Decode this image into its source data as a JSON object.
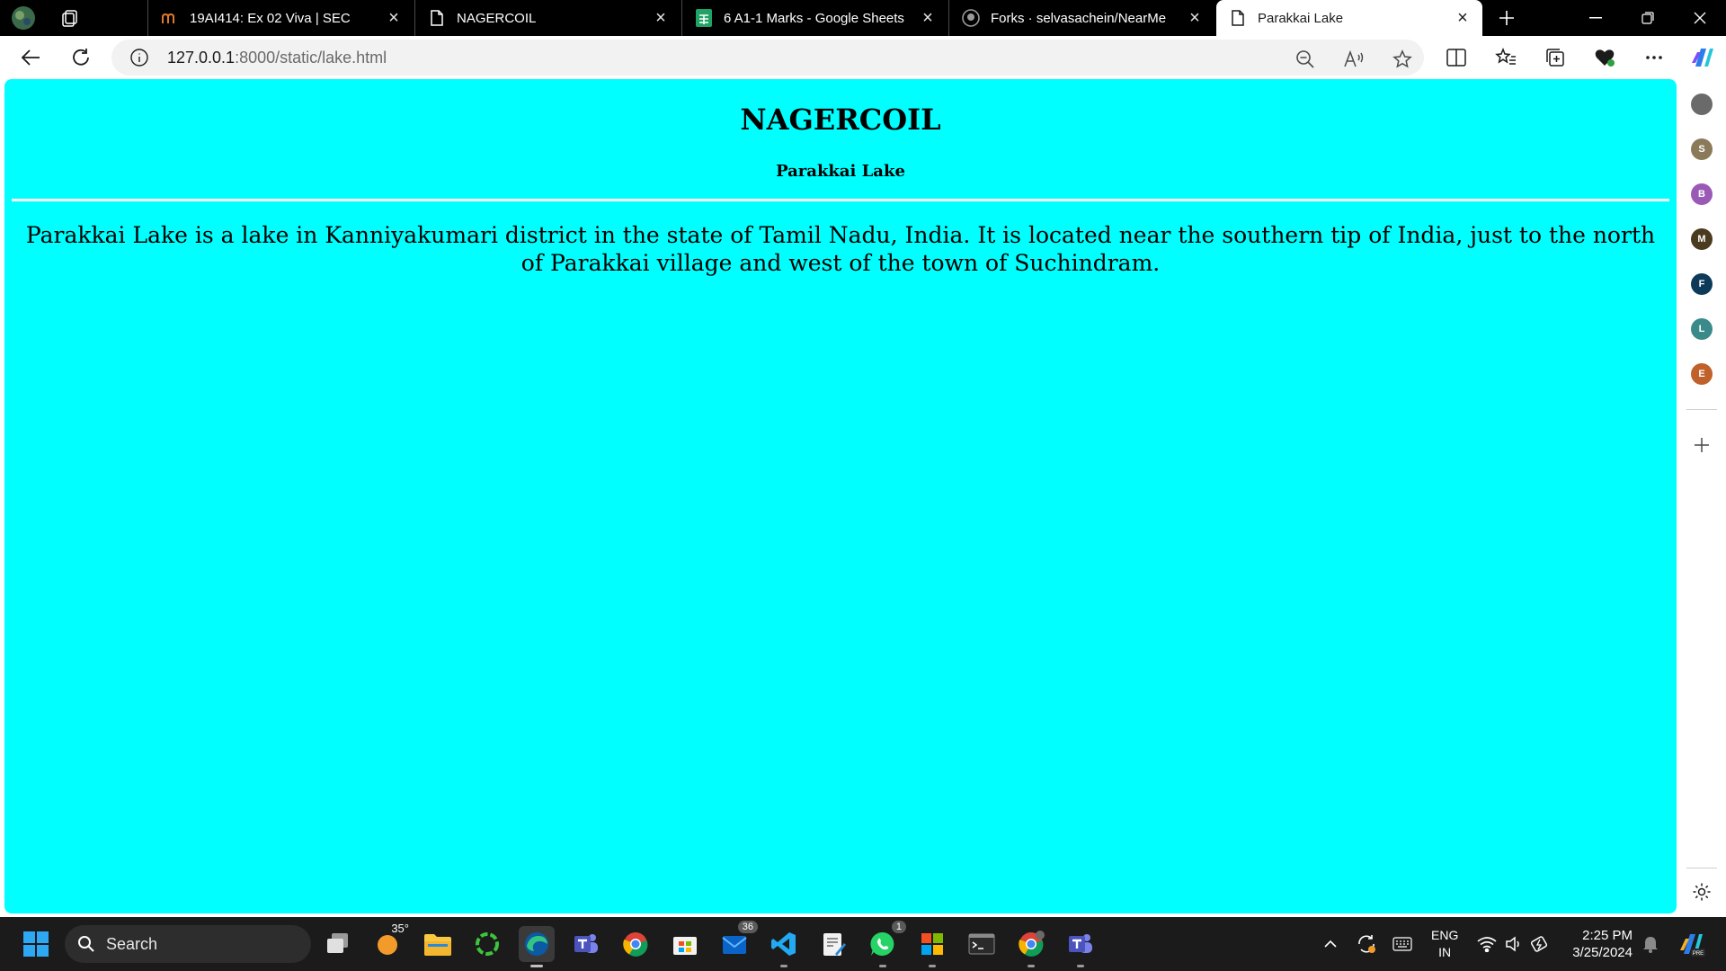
{
  "colors": {
    "page_bg": "#00ffff",
    "tabbar_bg": "#000000",
    "taskbar_bg": "#1b1b1b",
    "sheets_green": "#21a366",
    "edge_blue": "#0c59a4",
    "vscode_blue": "#23a9f2"
  },
  "tabs": [
    {
      "title": "19AI414: Ex 02 Viva | SEC",
      "favicon": "moodle-icon"
    },
    {
      "title": "NAGERCOIL",
      "favicon": "page-icon"
    },
    {
      "title": "6 A1-1 Marks - Google Sheets",
      "favicon": "sheets-icon"
    },
    {
      "title": "Forks · selvasachein/NearMe",
      "favicon": "github-icon"
    },
    {
      "title": "Parakkai Lake",
      "favicon": "page-icon",
      "active": true
    }
  ],
  "address": {
    "host": "127.0.0.1",
    "path": ":8000/static/lake.html"
  },
  "sidebar": {
    "avatars": [
      {
        "letter": "S",
        "color": "#8a7a5a"
      },
      {
        "letter": "B",
        "color": "#9b59b6"
      },
      {
        "letter": "M",
        "color": "#4a3a20"
      },
      {
        "letter": "F",
        "color": "#0e3a5a"
      },
      {
        "letter": "L",
        "color": "#3a8a8a"
      },
      {
        "letter": "E",
        "color": "#c0602a"
      }
    ]
  },
  "page": {
    "heading": "NAGERCOIL",
    "subheading": "Parakkai Lake",
    "paragraph": "Parakkai Lake is a lake in Kanniyakumari district in the state of Tamil Nadu, India. It is located near the southern tip of India, just to the north of Parakkai village and west of the town of Suchindram."
  },
  "taskbar": {
    "search_label": "Search",
    "weather_temp": "35°",
    "mail_badge": "36",
    "whatsapp_badge": "1",
    "language_top": "ENG",
    "language_bottom": "IN",
    "time": "2:25 PM",
    "date": "3/25/2024"
  }
}
